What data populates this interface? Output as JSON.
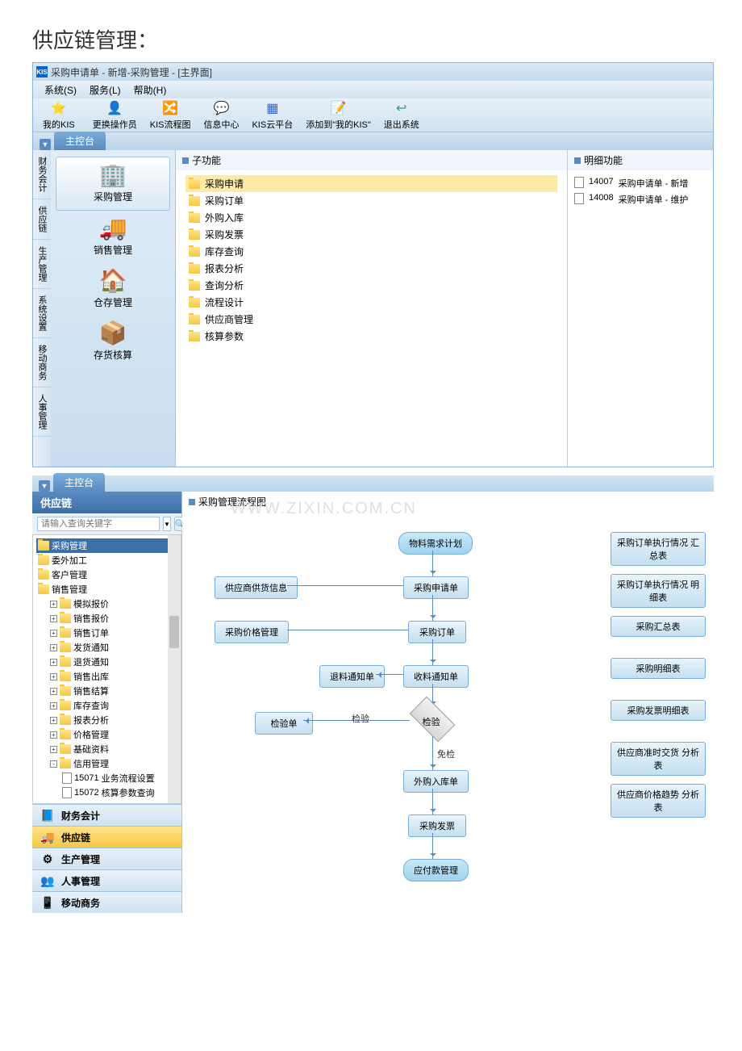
{
  "page_title": "供应链管理：",
  "window": {
    "title": "采购申请单 - 新增-采购管理 - [主界面]",
    "icon_text": "KIS"
  },
  "menubar": [
    "系统(S)",
    "服务(L)",
    "帮助(H)"
  ],
  "toolbar": [
    {
      "icon": "⭐",
      "label": "我的KIS",
      "color": "#d43"
    },
    {
      "icon": "👤",
      "label": "更换操作员",
      "color": "#c77"
    },
    {
      "icon": "🔀",
      "label": "KIS流程图",
      "color": "#36c"
    },
    {
      "icon": "💬",
      "label": "信息中心",
      "color": "#c93"
    },
    {
      "icon": "▦",
      "label": "KIS云平台",
      "color": "#36c"
    },
    {
      "icon": "📝",
      "label": "添加到\"我的KIS\"",
      "color": "#36c"
    },
    {
      "icon": "↩",
      "label": "退出系统",
      "color": "#399"
    }
  ],
  "tab_label": "主控台",
  "vtabs": [
    "财务会计",
    "供应链",
    "生产管理",
    "系统设置",
    "移动商务",
    "人事管理"
  ],
  "nav_items": [
    {
      "icon": "🏢",
      "label": "采购管理",
      "active": true
    },
    {
      "icon": "🚚",
      "label": "销售管理"
    },
    {
      "icon": "🏠",
      "label": "仓存管理"
    },
    {
      "icon": "📦",
      "label": "存货核算"
    }
  ],
  "sub_header": "子功能",
  "sub_items": [
    "采购申请",
    "采购订单",
    "外购入库",
    "采购发票",
    "库存查询",
    "报表分析",
    "查询分析",
    "流程设计",
    "供应商管理",
    "核算参数"
  ],
  "detail_header": "明细功能",
  "detail_items": [
    {
      "code": "14007",
      "label": "采购申请单 - 新增"
    },
    {
      "code": "14008",
      "label": "采购申请单 - 维护"
    }
  ],
  "panel2": {
    "tab": "主控台",
    "title": "供应链",
    "search_placeholder": "请输入查询关键字",
    "tree": [
      {
        "label": "采购管理",
        "sel": true,
        "lvl": 0
      },
      {
        "label": "委外加工",
        "lvl": 0
      },
      {
        "label": "客户管理",
        "lvl": 0
      },
      {
        "label": "销售管理",
        "lvl": 0
      },
      {
        "label": "模拟报价",
        "exp": "+",
        "lvl": 1
      },
      {
        "label": "销售报价",
        "exp": "+",
        "lvl": 1
      },
      {
        "label": "销售订单",
        "exp": "+",
        "lvl": 1
      },
      {
        "label": "发货通知",
        "exp": "+",
        "lvl": 1
      },
      {
        "label": "退货通知",
        "exp": "+",
        "lvl": 1
      },
      {
        "label": "销售出库",
        "exp": "+",
        "lvl": 1
      },
      {
        "label": "销售结算",
        "exp": "+",
        "lvl": 1
      },
      {
        "label": "库存查询",
        "exp": "+",
        "lvl": 1
      },
      {
        "label": "报表分析",
        "exp": "+",
        "lvl": 1
      },
      {
        "label": "价格管理",
        "exp": "+",
        "lvl": 1
      },
      {
        "label": "基础资料",
        "exp": "+",
        "lvl": 1
      },
      {
        "label": "信用管理",
        "exp": "-",
        "lvl": 1
      },
      {
        "code": "15071",
        "label": "业务流程设置",
        "lvl": 2,
        "doc": true
      },
      {
        "code": "15072",
        "label": "核算参数查询",
        "lvl": 2,
        "doc": true
      }
    ],
    "bottom_nav": [
      {
        "icon": "📘",
        "label": "财务会计"
      },
      {
        "icon": "🚚",
        "label": "供应链",
        "active": true
      },
      {
        "icon": "⚙",
        "label": "生产管理"
      },
      {
        "icon": "👥",
        "label": "人事管理"
      },
      {
        "icon": "📱",
        "label": "移动商务"
      }
    ],
    "flow_header": "采购管理流程图",
    "watermark": "WWW.ZIXIN.COM.CN",
    "flow_boxes": {
      "start": "物料需求计划",
      "b1": "供应商供货信息",
      "b2": "采购申请单",
      "b3": "采购价格管理",
      "b4": "采购订单",
      "b5": "退料通知单",
      "b6": "收料通知单",
      "b7": "检验单",
      "diamond": "检验",
      "t_check": "检验",
      "t_skip": "免检",
      "b8": "外购入库单",
      "b9": "采购发票",
      "end": "应付款管理"
    },
    "side_buttons": [
      "采购订单执行情况 汇总表",
      "采购订单执行情况 明细表",
      "采购汇总表",
      "采购明细表",
      "采购发票明细表",
      "供应商准时交货 分析表",
      "供应商价格趋势 分析表"
    ]
  }
}
